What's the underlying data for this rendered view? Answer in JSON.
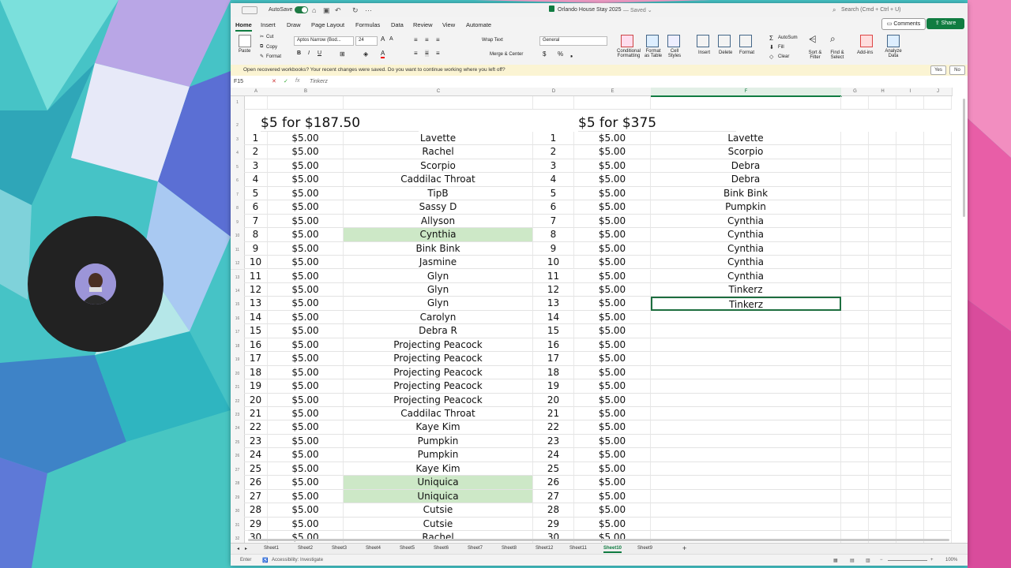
{
  "titlebar": {
    "autosave_label": "AutoSave",
    "doc_title": "Orlando House Stay 2025",
    "saved_status": "— Saved ⌄",
    "search_placeholder": "Search (Cmd + Ctrl + U)"
  },
  "menu": {
    "tabs": [
      "Home",
      "Insert",
      "Draw",
      "Page Layout",
      "Formulas",
      "Data",
      "Review",
      "View",
      "Automate"
    ],
    "comments_label": "Comments",
    "share_label": "Share"
  },
  "ribbon": {
    "paste": "Paste",
    "cut": "Cut",
    "copy": "Copy",
    "format": "Format",
    "font_name": "Aptos Narrow (Bod...",
    "font_size": "24",
    "wrap_text": "Wrap Text",
    "merge_center": "Merge & Center",
    "number_format": "General",
    "conditional_formatting": "Conditional Formatting",
    "format_as_table": "Format as Table",
    "cell_styles": "Cell Styles",
    "insert": "Insert",
    "delete": "Delete",
    "format_cells": "Format",
    "autosum": "AutoSum",
    "fill": "Fill",
    "clear": "Clear",
    "sort_filter": "Sort & Filter",
    "find_select": "Find & Select",
    "add_ins": "Add-ins",
    "analyze_data": "Analyze Data"
  },
  "infobar": {
    "message": "Open recovered workbooks?  Your recent changes were saved. Do you want to continue working where you left off?",
    "yes": "Yes",
    "no": "No"
  },
  "formula_bar": {
    "name_box": "F15",
    "content": "Tinkerz"
  },
  "columns": [
    "A",
    "B",
    "C",
    "D",
    "E",
    "F",
    "G",
    "H",
    "I",
    "J"
  ],
  "headers": {
    "left_title": "$5 for $187.50",
    "right_title": "$5 for $375"
  },
  "rows": [
    {
      "n1": "1",
      "p1": "$5.00",
      "name1": "Lavette",
      "n2": "1",
      "p2": "$5.00",
      "name2": "Lavette"
    },
    {
      "n1": "2",
      "p1": "$5.00",
      "name1": "Rachel",
      "n2": "2",
      "p2": "$5.00",
      "name2": "Scorpio"
    },
    {
      "n1": "3",
      "p1": "$5.00",
      "name1": "Scorpio",
      "n2": "3",
      "p2": "$5.00",
      "name2": "Debra"
    },
    {
      "n1": "4",
      "p1": "$5.00",
      "name1": "Caddilac Throat",
      "n2": "4",
      "p2": "$5.00",
      "name2": "Debra"
    },
    {
      "n1": "5",
      "p1": "$5.00",
      "name1": "TipB",
      "n2": "5",
      "p2": "$5.00",
      "name2": "Bink Bink"
    },
    {
      "n1": "6",
      "p1": "$5.00",
      "name1": "Sassy D",
      "n2": "6",
      "p2": "$5.00",
      "name2": "Pumpkin"
    },
    {
      "n1": "7",
      "p1": "$5.00",
      "name1": "Allyson",
      "n2": "7",
      "p2": "$5.00",
      "name2": "Cynthia"
    },
    {
      "n1": "8",
      "p1": "$5.00",
      "name1": "Cynthia",
      "n2": "8",
      "p2": "$5.00",
      "name2": "Cynthia"
    },
    {
      "n1": "9",
      "p1": "$5.00",
      "name1": "Bink Bink",
      "n2": "9",
      "p2": "$5.00",
      "name2": "Cynthia"
    },
    {
      "n1": "10",
      "p1": "$5.00",
      "name1": "Jasmine",
      "n2": "10",
      "p2": "$5.00",
      "name2": "Cynthia"
    },
    {
      "n1": "11",
      "p1": "$5.00",
      "name1": "Glyn",
      "n2": "11",
      "p2": "$5.00",
      "name2": "Cynthia"
    },
    {
      "n1": "12",
      "p1": "$5.00",
      "name1": "Glyn",
      "n2": "12",
      "p2": "$5.00",
      "name2": "Tinkerz"
    },
    {
      "n1": "13",
      "p1": "$5.00",
      "name1": "Glyn",
      "n2": "13",
      "p2": "$5.00",
      "name2": "Tinkerz"
    },
    {
      "n1": "14",
      "p1": "$5.00",
      "name1": "Carolyn",
      "n2": "14",
      "p2": "$5.00",
      "name2": ""
    },
    {
      "n1": "15",
      "p1": "$5.00",
      "name1": "Debra R",
      "n2": "15",
      "p2": "$5.00",
      "name2": ""
    },
    {
      "n1": "16",
      "p1": "$5.00",
      "name1": "Projecting Peacock",
      "n2": "16",
      "p2": "$5.00",
      "name2": ""
    },
    {
      "n1": "17",
      "p1": "$5.00",
      "name1": "Projecting Peacock",
      "n2": "17",
      "p2": "$5.00",
      "name2": ""
    },
    {
      "n1": "18",
      "p1": "$5.00",
      "name1": "Projecting Peacock",
      "n2": "18",
      "p2": "$5.00",
      "name2": ""
    },
    {
      "n1": "19",
      "p1": "$5.00",
      "name1": "Projecting Peacock",
      "n2": "19",
      "p2": "$5.00",
      "name2": ""
    },
    {
      "n1": "20",
      "p1": "$5.00",
      "name1": "Projecting Peacock",
      "n2": "20",
      "p2": "$5.00",
      "name2": ""
    },
    {
      "n1": "21",
      "p1": "$5.00",
      "name1": "Caddilac Throat",
      "n2": "21",
      "p2": "$5.00",
      "name2": ""
    },
    {
      "n1": "22",
      "p1": "$5.00",
      "name1": "Kaye Kim",
      "n2": "22",
      "p2": "$5.00",
      "name2": ""
    },
    {
      "n1": "23",
      "p1": "$5.00",
      "name1": "Pumpkin",
      "n2": "23",
      "p2": "$5.00",
      "name2": ""
    },
    {
      "n1": "24",
      "p1": "$5.00",
      "name1": "Pumpkin",
      "n2": "24",
      "p2": "$5.00",
      "name2": ""
    },
    {
      "n1": "25",
      "p1": "$5.00",
      "name1": "Kaye Kim",
      "n2": "25",
      "p2": "$5.00",
      "name2": ""
    },
    {
      "n1": "26",
      "p1": "$5.00",
      "name1": "Uniquica",
      "n2": "26",
      "p2": "$5.00",
      "name2": ""
    },
    {
      "n1": "27",
      "p1": "$5.00",
      "name1": "Uniquica",
      "n2": "27",
      "p2": "$5.00",
      "name2": ""
    },
    {
      "n1": "28",
      "p1": "$5.00",
      "name1": "Cutsie",
      "n2": "28",
      "p2": "$5.00",
      "name2": ""
    },
    {
      "n1": "29",
      "p1": "$5.00",
      "name1": "Cutsie",
      "n2": "29",
      "p2": "$5.00",
      "name2": ""
    },
    {
      "n1": "30",
      "p1": "$5.00",
      "name1": "Rachel",
      "n2": "30",
      "p2": "$5.00",
      "name2": ""
    }
  ],
  "highlighted_rows_col_c": [
    7,
    25,
    26
  ],
  "selected_row_col_f": 12,
  "highlight_color": "#cde8c7",
  "accent_color": "#107c41",
  "sheets": [
    "Sheet1",
    "Sheet2",
    "Sheet3",
    "Sheet4",
    "Sheet5",
    "Sheet6",
    "Sheet7",
    "Sheet8",
    "Sheet12",
    "Sheet11",
    "Sheet10",
    "Sheet9"
  ],
  "active_sheet": "Sheet10",
  "status": {
    "mode": "Enter",
    "accessibility": "Accessibility: Investigate",
    "zoom": "100%"
  }
}
